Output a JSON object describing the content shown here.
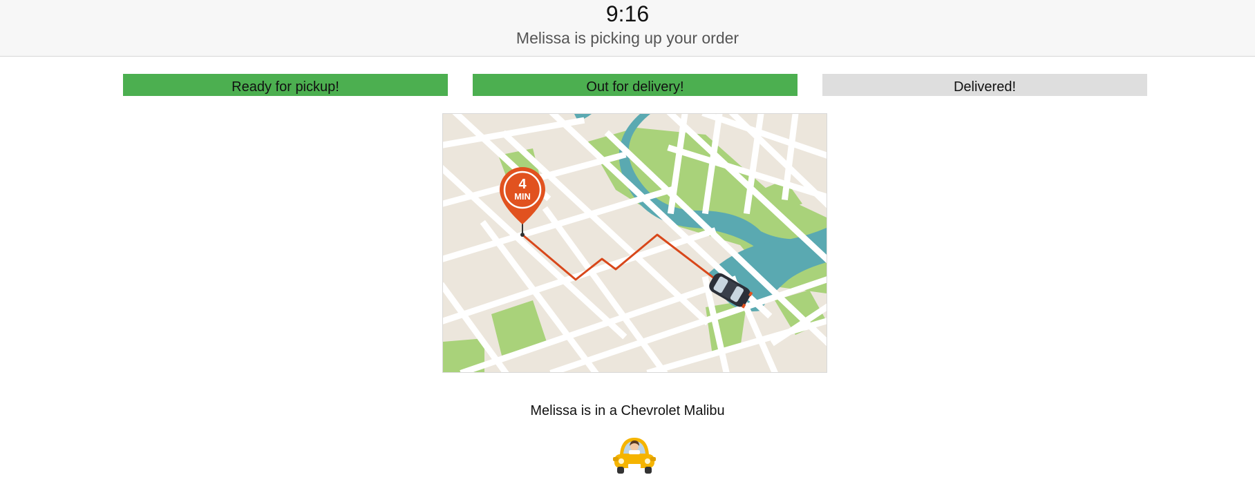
{
  "header": {
    "time": "9:16",
    "status": "Melissa is picking up your order"
  },
  "steps": [
    {
      "label": "Ready for pickup!",
      "state": "done"
    },
    {
      "label": "Out for delivery!",
      "state": "done"
    },
    {
      "label": "Delivered!",
      "state": "pending"
    }
  ],
  "map": {
    "eta_number": "4",
    "eta_unit": "MIN",
    "pin_icon": "map-pin-icon",
    "vehicle_icon": "car-icon"
  },
  "vehicle": {
    "description": "Melissa is in a Chevrolet Malibu",
    "icon": "driver-in-car-icon"
  },
  "colors": {
    "step_done": "#4caf50",
    "step_pending": "#dedede",
    "route": "#d8471a",
    "water": "#5aa9b1",
    "park": "#a9d27a",
    "map_bg": "#ece6dc"
  }
}
